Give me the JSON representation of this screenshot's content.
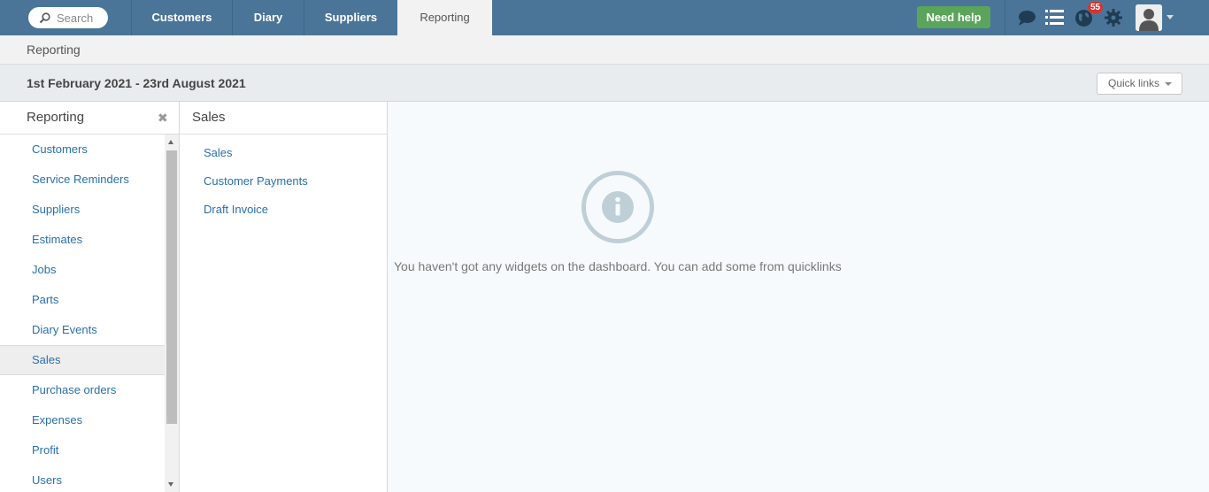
{
  "topbar": {
    "search_placeholder": "Search",
    "tabs": [
      {
        "label": "Customers"
      },
      {
        "label": "Diary"
      },
      {
        "label": "Suppliers"
      },
      {
        "label": "Reporting",
        "active": true
      }
    ],
    "help_label": "Need help",
    "notification_count": "55",
    "icons": [
      "search-icon",
      "chat-icon",
      "list-icon",
      "globe-icon",
      "gear-icon",
      "user-avatar-icon"
    ]
  },
  "breadcrumb": {
    "label": "Reporting"
  },
  "datebar": {
    "range": "1st February 2021 - 23rd August 2021",
    "quick_links": "Quick links"
  },
  "left_panel": {
    "title": "Reporting",
    "items": [
      {
        "label": "Customers"
      },
      {
        "label": "Service Reminders"
      },
      {
        "label": "Suppliers"
      },
      {
        "label": "Estimates"
      },
      {
        "label": "Jobs"
      },
      {
        "label": "Parts"
      },
      {
        "label": "Diary Events"
      },
      {
        "label": "Sales",
        "active": true
      },
      {
        "label": "Purchase orders"
      },
      {
        "label": "Expenses"
      },
      {
        "label": "Profit"
      },
      {
        "label": "Users"
      }
    ]
  },
  "mid_panel": {
    "title": "Sales",
    "items": [
      {
        "label": "Sales"
      },
      {
        "label": "Customer Payments"
      },
      {
        "label": "Draft Invoice"
      }
    ]
  },
  "main": {
    "empty_message": "You haven't got any widgets on the dashboard. You can add some from quicklinks"
  },
  "colors": {
    "topbar": "#4a7598",
    "link": "#2a6fab",
    "help_button": "#5aa55a",
    "badge": "#d9332b"
  }
}
